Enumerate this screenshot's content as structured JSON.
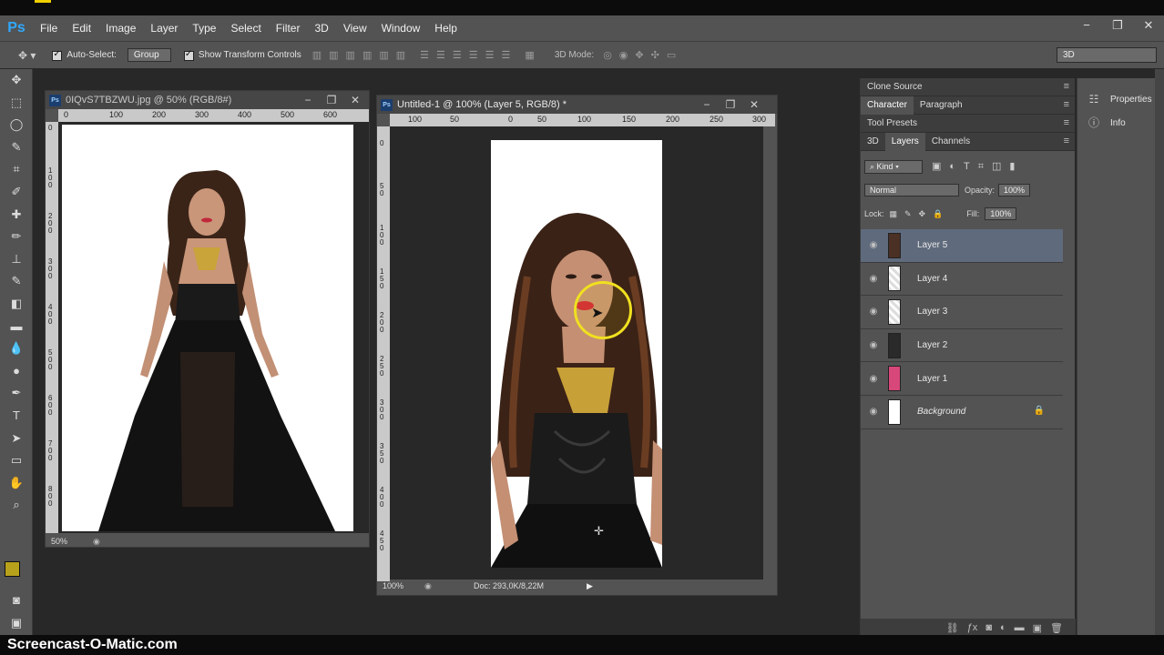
{
  "app": {
    "logo": "Ps"
  },
  "menu": [
    "File",
    "Edit",
    "Image",
    "Layer",
    "Type",
    "Select",
    "Filter",
    "3D",
    "View",
    "Window",
    "Help"
  ],
  "window_controls": {
    "minimize": "−",
    "restore": "❐",
    "close": "✕"
  },
  "options": {
    "auto_select_label": "Auto-Select:",
    "auto_select_value": "Group",
    "transform_label": "Show Transform Controls",
    "mode_3d_label": "3D Mode:",
    "workspace": "3D"
  },
  "doc1": {
    "title": "0IQvS7TBZWU.jpg @ 50% (RGB/8#)",
    "zoom": "50%",
    "ruler_h": [
      "0",
      "100",
      "200",
      "300",
      "400",
      "500",
      "600"
    ],
    "ruler_v": [
      "0",
      "1\n0\n0",
      "2\n0\n0",
      "3\n0\n0",
      "4\n0\n0",
      "5\n0\n0",
      "6\n0\n0",
      "7\n0\n0",
      "8\n0\n0"
    ]
  },
  "doc2": {
    "title": "Untitled-1 @ 100% (Layer 5, RGB/8) *",
    "zoom": "100%",
    "doc_info": "Doc: 293,0K/8,22M",
    "ruler_h": [
      "100",
      "50",
      "0",
      "50",
      "100",
      "150",
      "200",
      "250",
      "300"
    ],
    "ruler_v": [
      "0",
      "5\n0",
      "1\n0\n0",
      "1\n5\n0",
      "2\n0\n0",
      "2\n5\n0",
      "3\n0\n0",
      "3\n5\n0",
      "4\n0\n0",
      "4\n5\n0"
    ]
  },
  "panels": {
    "group1": [
      "Clone Source"
    ],
    "group2": [
      "Character",
      "Paragraph"
    ],
    "group3": [
      "Tool Presets"
    ],
    "layers_tabs": [
      "3D",
      "Layers",
      "Channels"
    ],
    "filter_kind": "Kind",
    "blend_mode": "Normal",
    "opacity_label": "Opacity:",
    "opacity_value": "100%",
    "lock_label": "Lock:",
    "fill_label": "Fill:",
    "fill_value": "100%",
    "layers": [
      {
        "name": "Layer 5",
        "selected": true
      },
      {
        "name": "Layer 4",
        "selected": false
      },
      {
        "name": "Layer 3",
        "selected": false
      },
      {
        "name": "Layer 2",
        "selected": false
      },
      {
        "name": "Layer 1",
        "selected": false
      },
      {
        "name": "Background",
        "selected": false,
        "locked": true
      }
    ]
  },
  "dock": [
    "Properties",
    "Info"
  ],
  "colors": {
    "foreground": "#b8a21b",
    "background": "#ffffff",
    "selection": "#5f6a7c"
  },
  "watermark": "Screencast-O-Matic.com"
}
